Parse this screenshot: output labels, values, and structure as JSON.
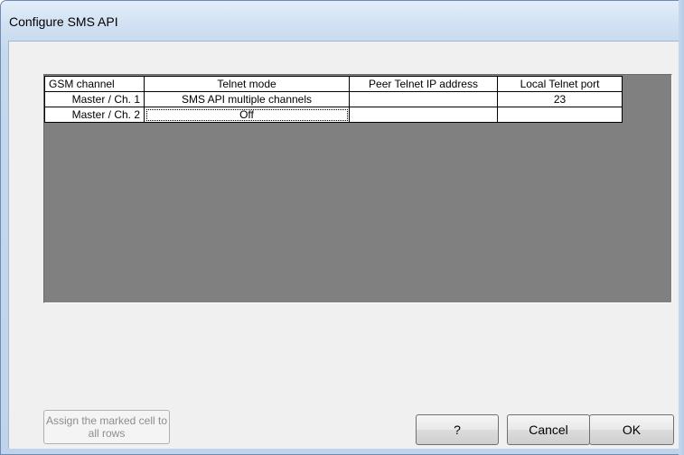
{
  "window": {
    "title": "Configure SMS API"
  },
  "table": {
    "headers": [
      "GSM channel",
      "Telnet mode",
      "Peer Telnet IP address",
      "Local Telnet port"
    ],
    "rows": [
      [
        "Master / Ch. 1",
        "SMS API multiple channels",
        "",
        "23"
      ],
      [
        "Master / Ch. 2",
        "Off",
        "",
        ""
      ]
    ]
  },
  "buttons": {
    "assign_label": "Assign the marked cell to all rows",
    "help_label": "?",
    "cancel_label": "Cancel",
    "ok_label": "OK"
  }
}
